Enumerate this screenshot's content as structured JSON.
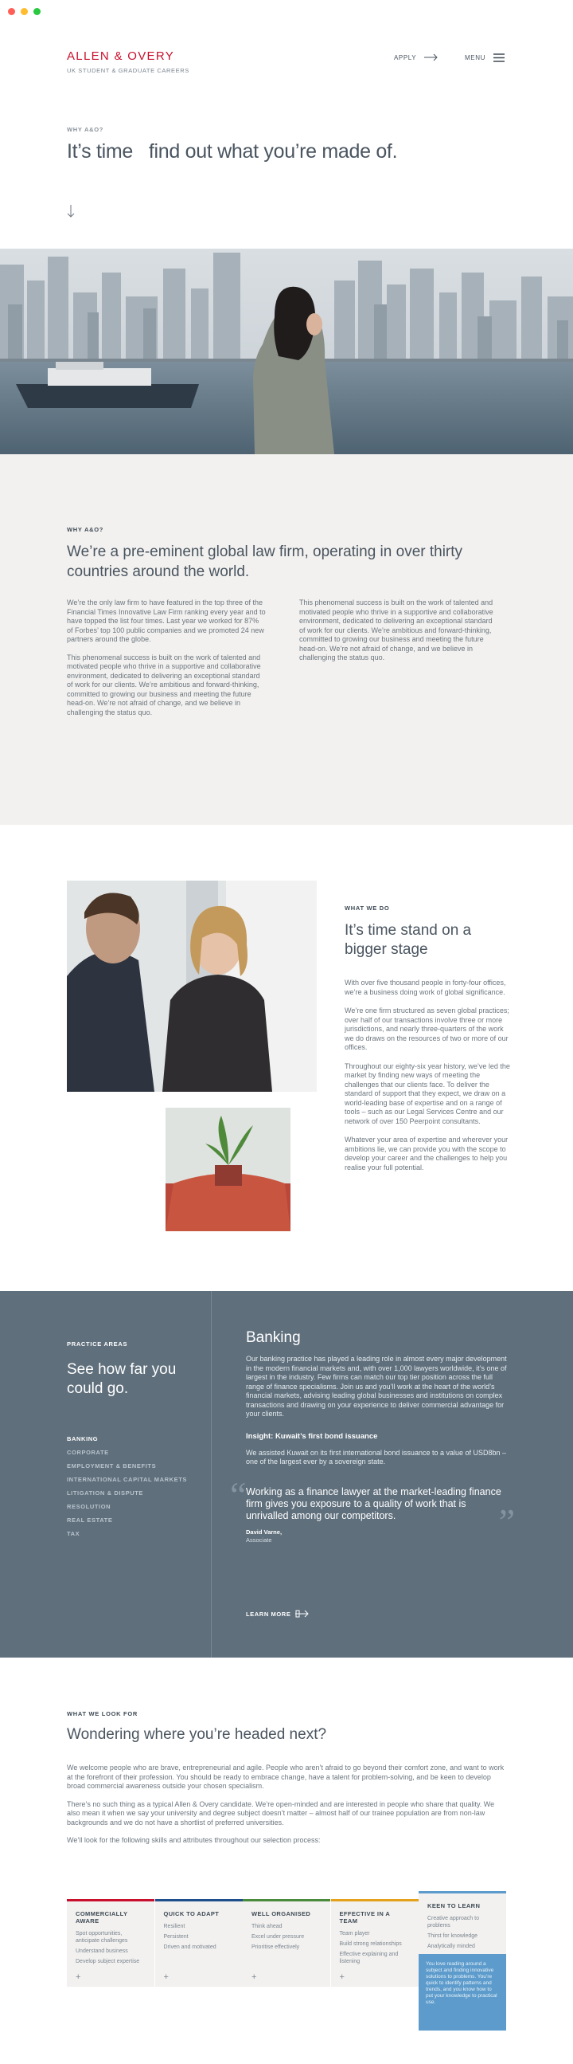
{
  "browser": {
    "dots": [
      {
        "name": "close-dot",
        "color": "#ff5f57"
      },
      {
        "name": "minimize-dot",
        "color": "#febc2e"
      },
      {
        "name": "maximize-dot",
        "color": "#28c840"
      }
    ]
  },
  "header": {
    "logo": "ALLEN & OVERY",
    "logo_sub": "UK STUDENT & GRADUATE CAREERS",
    "apply_label": "APPLY",
    "menu_label": "MENU",
    "brand_color": "#c8102e"
  },
  "hero": {
    "eyebrow": "WHY A&O?",
    "title": "It’s time   find out what you’re made of."
  },
  "why": {
    "eyebrow": "WHY A&O?",
    "heading": "We’re a pre-eminent global law firm, operating in over thirty countries around the world.",
    "col1_p1": "We’re the only law firm to have featured in the top three of the Financial Times Innovative Law Firm ranking every year and to have topped the list four times. Last year we worked for 87% of Forbes’ top 100 public companies and we promoted 24 new partners around the globe.",
    "col1_p2": "This phenomenal success is built on the work of talented and motivated people who thrive in a supportive and collaborative environment, dedicated to delivering an exceptional standard of work for our clients. We’re ambitious and forward-thinking, committed to growing our business and meeting the future head-on. We’re not afraid of change, and we believe in challenging the status quo.",
    "col2_p1": "This phenomenal success is built on the work of talented and motivated people who thrive in a supportive and collaborative environment, dedicated to delivering an exceptional standard of work for our clients. We’re ambitious and forward-thinking, committed to growing our business and meeting the future head-on. We’re not afraid of change, and we believe in challenging the status quo."
  },
  "what_we_do": {
    "eyebrow": "WHAT WE DO",
    "heading": "It’s time stand on a bigger stage",
    "p1": "With over five thousand people in forty-four offices, we’re a business doing work of global significance.",
    "p2": "We’re one firm structured as seven global practices; over half of our transactions involve three or more jurisdictions, and nearly three-quarters of the work we do draws on the resources of two or more of our offices.",
    "p3": "Throughout our eighty-six year history, we’ve led the market by finding new ways of meeting the challenges that our clients face. To deliver the standard of support that they expect, we draw on a world-leading base of expertise and on a range of tools – such as our Legal Services Centre and our network of over 150 Peerpoint consultants.",
    "p4": "Whatever your area of expertise and wherever your ambitions lie, we can provide you with the scope to develop your career and the challenges to help you realise your full potential."
  },
  "practice": {
    "eyebrow": "PRACTICE AREAS",
    "heading": "See how far you could go.",
    "areas": [
      "BANKING",
      "CORPORATE",
      "EMPLOYMENT & BENEFITS",
      "INTERNATIONAL CAPITAL MARKETS",
      "LITIGATION & DISPUTE",
      "RESOLUTION",
      "REAL ESTATE",
      "TAX"
    ],
    "selected": "BANKING",
    "title": "Banking",
    "body": "Our banking practice has played a leading role in almost every major development in the modern financial markets and, with over 1,000 lawyers worldwide, it’s one of largest in the industry. Few firms can match our top tier position across the full range of finance specialisms. Join us and you’ll work at the heart of the world’s financial markets, advising leading global businesses and institutions on complex transactions and drawing on your experience to deliver commercial advantage for your clients.",
    "insight_title": "Insight: Kuwait’s first bond issuance",
    "insight_body": "We assisted Kuwait on its first international bond issuance to a value of USD8bn – one of the largest ever by a sovereign state.",
    "quote": "Working as a finance lawyer at the market-leading finance firm gives you exposure to a quality of work that is unrivalled among our competitors.",
    "quote_name": "David Varne,",
    "quote_role": "Associate",
    "learn_more": "LEARN MORE",
    "bg_color": "#5f6f7c"
  },
  "look_for": {
    "eyebrow": "WHAT WE LOOK FOR",
    "heading": "Wondering where you’re headed next?",
    "p1": "We welcome people who are brave, entrepreneurial and agile. People who aren’t afraid to go beyond their comfort zone, and want to work at the forefront of their profession.  You should be ready to embrace change, have a talent for problem-solving, and be keen to develop broad commercial awareness outside your chosen specialism.",
    "p2": "There’s no such thing as a typical Allen & Overy candidate. We’re open-minded and are interested in people who share that quality. We also mean it when we say your university and degree subject doesn’t matter – almost half of our trainee population are from non-law backgrounds and we do not have a shortlist of preferred universities.",
    "p3": "We’ll look for the following skills and attributes throughout our selection process:",
    "cards": [
      {
        "title": "COMMERCIALLY AWARE",
        "items": [
          "Spot opportunities, anticipate challenges",
          "Understand business",
          "Develop subject expertise"
        ],
        "color": "#c8102e"
      },
      {
        "title": "QUICK TO ADAPT",
        "items": [
          "Resilient",
          "Persistent",
          "Driven and motivated"
        ],
        "color": "#1f4e8c"
      },
      {
        "title": "WELL ORGANISED",
        "items": [
          "Think ahead",
          "Excel under pressure",
          "Prioritise effectively"
        ],
        "color": "#4a8a3c"
      },
      {
        "title": "EFFECTIVE IN A TEAM",
        "items": [
          "Team player",
          "Build strong relationships",
          "Effective explaining and listening"
        ],
        "color": "#e3a21a"
      },
      {
        "title": "KEEN TO LEARN",
        "items": [
          "Creative approach to problems",
          "Thirst for knowledge",
          "Analytically minded"
        ],
        "color": "#5c9bcb"
      }
    ],
    "expanded_text": "You love reading around a subject and finding innovative solutions to problems. You’re quick to identify patterns and trends, and you know how to put your knowledge to practical use.",
    "plus": "+"
  }
}
